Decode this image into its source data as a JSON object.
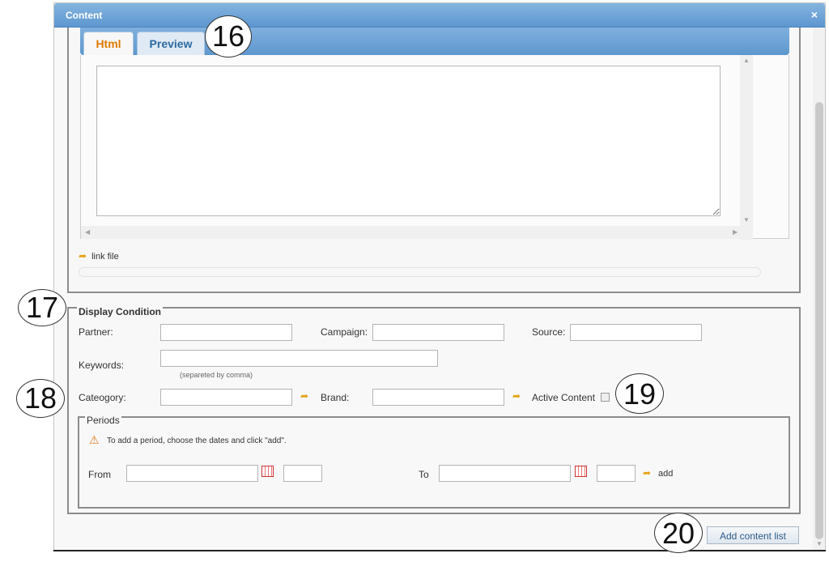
{
  "dialog": {
    "title": "Content",
    "close_glyph": "×"
  },
  "tabs": [
    {
      "label": "Html"
    },
    {
      "label": "Preview"
    }
  ],
  "editor": {
    "link_file_label": "link file"
  },
  "display_condition": {
    "legend": "Display Condition",
    "partner_label": "Partner:",
    "campaign_label": "Campaign:",
    "source_label": "Source:",
    "keywords_label": "Keywords:",
    "keywords_hint": "(separeted by comma)",
    "category_label": "Cateogory:",
    "brand_label": "Brand:",
    "active_content_label": "Active Content",
    "active_content_checked": false
  },
  "periods": {
    "legend": "Periods",
    "warning": "To add a period, choose the dates and click \"add\".",
    "from_label": "From",
    "to_label": "To",
    "add_label": "add"
  },
  "footer": {
    "add_content_list_label": "Add content list"
  },
  "callouts": [
    "16",
    "17",
    "18",
    "19",
    "20"
  ],
  "colors": {
    "titlebar": "#6fa6d9",
    "active_tab_text": "#e07a00",
    "inactive_tab_text": "#2c6aa0",
    "icon_accent": "#e6a318"
  }
}
